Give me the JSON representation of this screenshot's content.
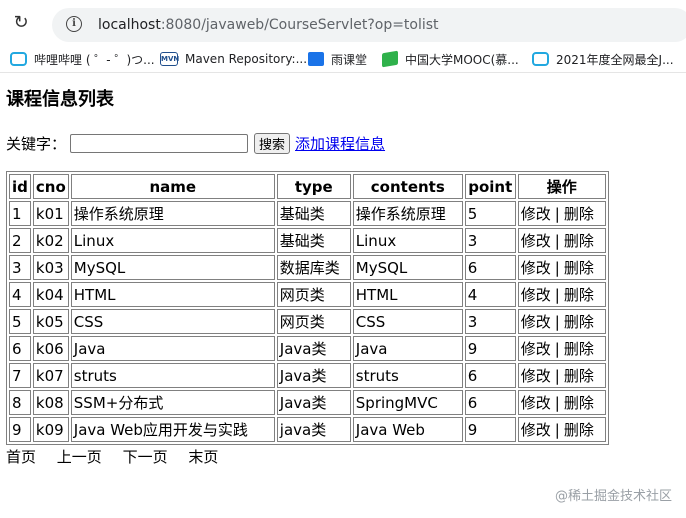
{
  "browser": {
    "url_host": "localhost",
    "url_rest": ":8080/javaweb/CourseServlet?op=tolist",
    "bookmarks": [
      {
        "label": "哔哩哔哩 ( ゜- ゜)つ...",
        "icon": "bilibili-icon"
      },
      {
        "label": "Maven Repository:...",
        "icon": "maven-icon"
      },
      {
        "label": "雨课堂",
        "icon": "yuketang-icon"
      },
      {
        "label": "中国大学MOOC(慕...",
        "icon": "mooc-icon"
      },
      {
        "label": "2021年度全网最全J...",
        "icon": "bilibili-icon"
      }
    ]
  },
  "page": {
    "title": "课程信息列表",
    "search_label": "关键字：",
    "search_value": "",
    "search_button": "搜索",
    "add_link": "添加课程信息"
  },
  "table": {
    "headers": [
      "id",
      "cno",
      "name",
      "type",
      "contents",
      "point",
      "操作"
    ],
    "edit_label": "修改",
    "separator": "|",
    "delete_label": "删除",
    "rows": [
      [
        "1",
        "k01",
        "操作系统原理",
        "基础类",
        "操作系统原理",
        "5"
      ],
      [
        "2",
        "k02",
        "Linux",
        "基础类",
        "Linux",
        "3"
      ],
      [
        "3",
        "k03",
        "MySQL",
        "数据库类",
        "MySQL",
        "6"
      ],
      [
        "4",
        "k04",
        "HTML",
        "网页类",
        "HTML",
        "4"
      ],
      [
        "5",
        "k05",
        "CSS",
        "网页类",
        "CSS",
        "3"
      ],
      [
        "6",
        "k06",
        "Java",
        "Java类",
        "Java",
        "9"
      ],
      [
        "7",
        "k07",
        "struts",
        "Java类",
        "struts",
        "6"
      ],
      [
        "8",
        "k08",
        "SSM+分布式",
        "Java类",
        "SpringMVC",
        "6"
      ],
      [
        "9",
        "k09",
        "Java Web应用开发与实践",
        "java类",
        "Java Web",
        "9"
      ]
    ]
  },
  "pager": {
    "first": "首页",
    "prev": "上一页",
    "next": "下一页",
    "last": "末页"
  },
  "watermark": "@稀土掘金技术社区"
}
